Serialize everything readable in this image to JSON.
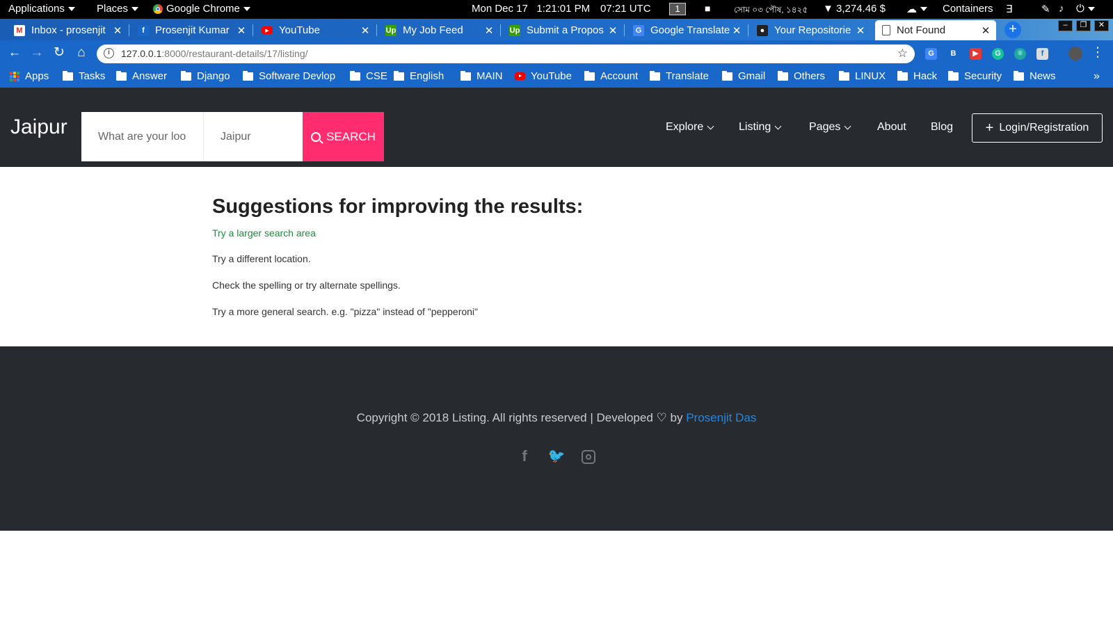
{
  "topbar": {
    "applications": "Applications",
    "places": "Places",
    "chrome": "Google Chrome",
    "datetime": "Mon Dec 17   1:21:01 PM",
    "utc": "07:21 UTC",
    "workspace": "1",
    "bengali_date": "সোম ০৩ পৌষ, ১৪২৫",
    "price": "▼ 3,274.46 $",
    "containers": "Containers"
  },
  "tabs": [
    {
      "title": "Inbox - prosenjit",
      "icon": "gmail-icon",
      "icon_color": "#ffffff",
      "glyph": "M"
    },
    {
      "title": "Prosenjit Kumar",
      "icon": "facebook-icon",
      "icon_color": "#1967c9",
      "glyph": "f"
    },
    {
      "title": "YouTube",
      "icon": "youtube-icon",
      "icon_color": "#ff0000",
      "glyph": "▶"
    },
    {
      "title": "My Job Feed",
      "icon": "upwork-icon",
      "icon_color": "#37a000",
      "glyph": "Up"
    },
    {
      "title": "Submit a Propos",
      "icon": "upwork-icon",
      "icon_color": "#37a000",
      "glyph": "Up"
    },
    {
      "title": "Google Translate",
      "icon": "translate-icon",
      "icon_color": "#4285f4",
      "glyph": "G"
    },
    {
      "title": "Your Repositorie",
      "icon": "github-icon",
      "icon_color": "#222222",
      "glyph": "●"
    },
    {
      "title": "Not Found",
      "icon": "page-icon",
      "icon_color": "#ffffff",
      "glyph": ""
    }
  ],
  "omnibox": {
    "host": "127.0.0.1",
    "path": ":8000/restaurant-details/17/listing/"
  },
  "bookmarks": [
    {
      "label": "Apps",
      "type": "apps"
    },
    {
      "label": "Tasks",
      "type": "folder"
    },
    {
      "label": "Answer",
      "type": "folder"
    },
    {
      "label": "Django",
      "type": "folder"
    },
    {
      "label": "Software Devlop",
      "type": "folder"
    },
    {
      "label": "CSE",
      "type": "folder"
    },
    {
      "label": "English",
      "type": "folder"
    },
    {
      "label": "MAIN",
      "type": "folder"
    },
    {
      "label": "YouTube",
      "type": "youtube"
    },
    {
      "label": "Account",
      "type": "folder"
    },
    {
      "label": "Translate",
      "type": "folder"
    },
    {
      "label": "Gmail",
      "type": "folder"
    },
    {
      "label": "Others",
      "type": "folder"
    },
    {
      "label": "LINUX",
      "type": "folder"
    },
    {
      "label": "Hack",
      "type": "folder"
    },
    {
      "label": "Security",
      "type": "folder"
    },
    {
      "label": "News",
      "type": "folder"
    }
  ],
  "site": {
    "logo": "Jaipur",
    "search_placeholder": "What are your loo",
    "location_placeholder": "Jaipur",
    "search_label": "SEARCH",
    "nav": {
      "explore": "Explore",
      "listing": "Listing",
      "pages": "Pages",
      "about": "About",
      "blog": "Blog"
    },
    "login": "Login/Registration"
  },
  "main": {
    "heading": "Suggestions for improving the results:",
    "link": "Try a larger search area",
    "tips": [
      "Try a different location.",
      "Check the spelling or try alternate spellings.",
      "Try a more general search. e.g. \"pizza\" instead of \"pepperoni\""
    ]
  },
  "footer": {
    "copyright_prefix": "Copyright © 2018 Listing. All rights reserved | Developed",
    "by": "by",
    "author": "Prosenjit Das"
  },
  "colors": {
    "header_bg": "#272b30",
    "search_button": "#ff2d6f",
    "link_green": "#1e8c3a",
    "author_link": "#1e88e5",
    "chrome_blue": "#1967c9"
  }
}
